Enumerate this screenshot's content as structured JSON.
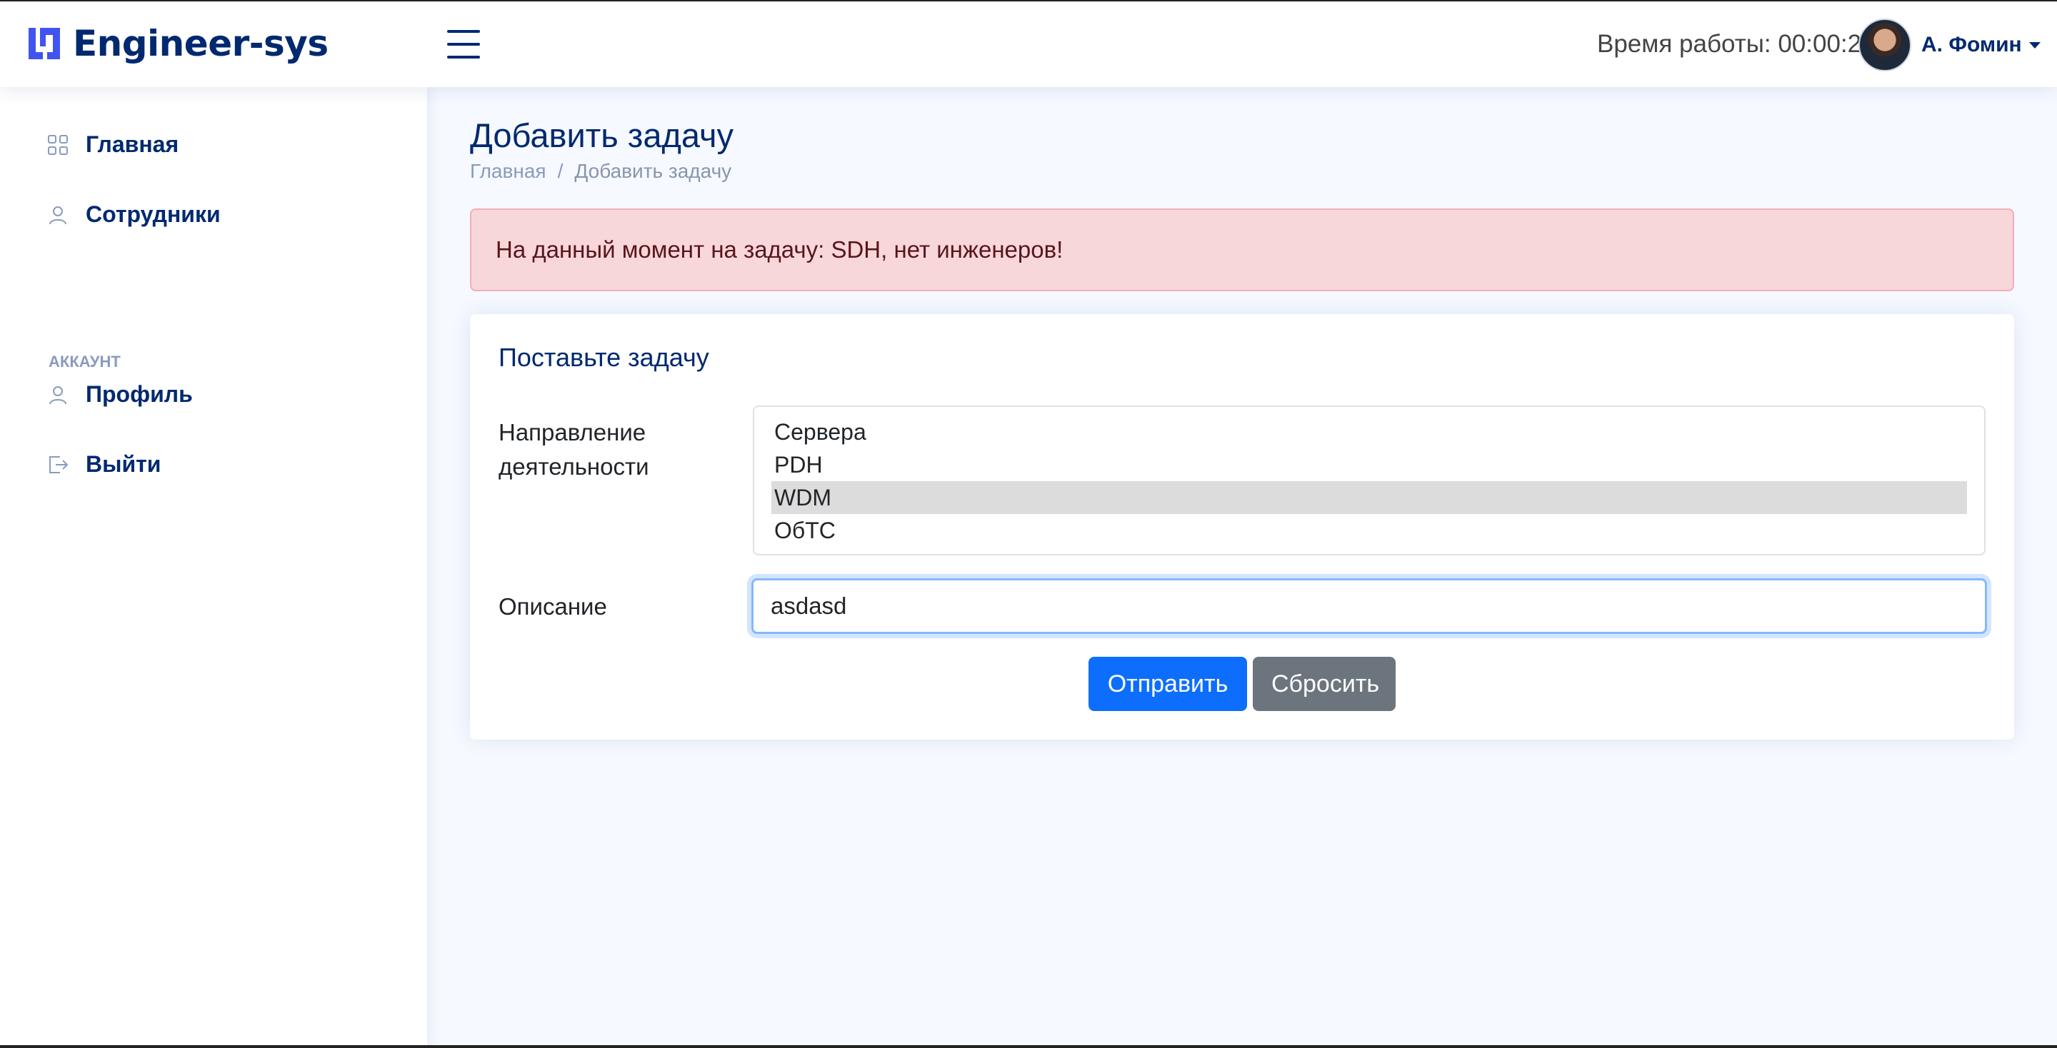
{
  "header": {
    "brand": "Engineer-sys",
    "worktime": "Время работы: 00:00:21",
    "user_name": "А. Фомин"
  },
  "sidebar": {
    "items": [
      {
        "label": "Главная",
        "icon": "grid-icon"
      },
      {
        "label": "Сотрудники",
        "icon": "person-icon"
      }
    ],
    "heading": "Аккаунт",
    "account_items": [
      {
        "label": "Профиль",
        "icon": "person-icon"
      },
      {
        "label": "Выйти",
        "icon": "logout-icon"
      }
    ]
  },
  "main": {
    "title": "Добавить задачу",
    "breadcrumb": {
      "home": "Главная",
      "separator": "/",
      "current": "Добавить задачу"
    },
    "alert": "На данный момент на задачу: SDH, нет инженеров!",
    "form": {
      "title": "Поставьте задачу",
      "direction_label": "Направление деятельности",
      "direction_options": [
        "Сервера",
        "PDH",
        "WDM",
        "ОбТС"
      ],
      "direction_selected": "WDM",
      "description_label": "Описание",
      "description_value": "asdasd",
      "submit_label": "Отправить",
      "reset_label": "Сбросить"
    }
  },
  "colors": {
    "brand": "#4154f1",
    "primary": "#0d6efd",
    "secondary": "#6c757d",
    "alert_bg": "#f8d7da",
    "navy": "#012970"
  }
}
